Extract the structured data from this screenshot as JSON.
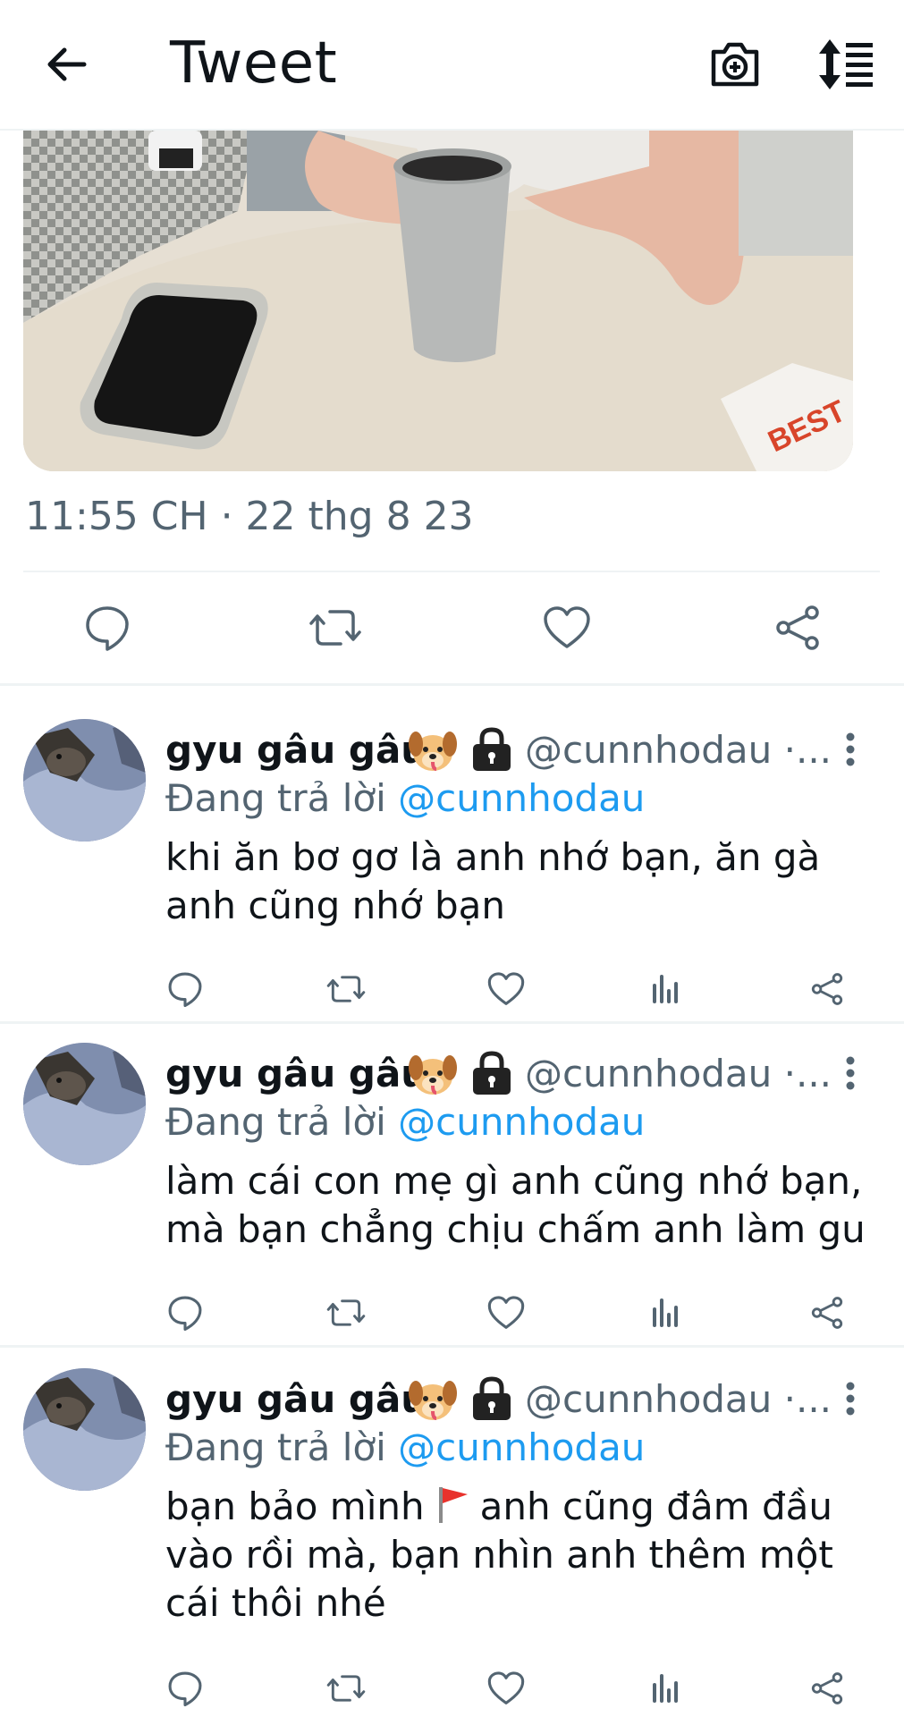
{
  "header": {
    "title": "Tweet",
    "icons": [
      "back-arrow-icon",
      "camera-plus-icon",
      "sort-thread-icon"
    ]
  },
  "tweet": {
    "timestamp": "11:55 CH · 22 thg 8 23",
    "actions": [
      "reply-icon",
      "retweet-icon",
      "like-icon",
      "share-icon"
    ]
  },
  "replies": [
    {
      "name": "gyu gâu gâu",
      "handle": "@cunnhodau ·...",
      "replying_label": "Đang trả lời",
      "replying_to": "@cunnhodau",
      "text": "khi ăn bơ gơ là anh nhớ bạn, ăn gà anh cũng nhớ bạn"
    },
    {
      "name": "gyu gâu gâu",
      "handle": "@cunnhodau ·...",
      "replying_label": "Đang trả lời",
      "replying_to": "@cunnhodau",
      "text": "làm cái con mẹ gì anh cũng nhớ bạn, mà bạn chẳng chịu chấm anh làm gu"
    },
    {
      "name": "gyu gâu gâu",
      "handle": "@cunnhodau ·...",
      "replying_label": "Đang trả lời",
      "replying_to": "@cunnhodau",
      "text_before_flag": "bạn bảo mình",
      "text_after_flag": "anh cũng đâm đầu vào rồi mà, bạn nhìn anh thêm một cái thôi nhé"
    }
  ],
  "colors": {
    "text": "#0f1419",
    "secondary": "#536471",
    "link": "#1d9bf0",
    "divider": "#eff3f4"
  }
}
